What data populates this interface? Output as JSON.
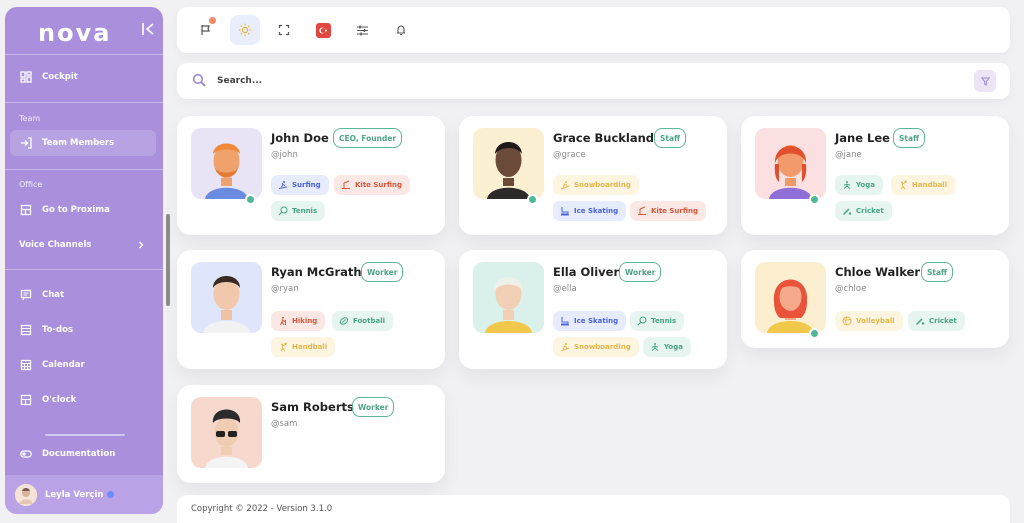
{
  "app": {
    "logo": "nova"
  },
  "sidebar": {
    "cockpit": "Cockpit",
    "team_section": "Team",
    "team_members": "Team Members",
    "office_section": "Office",
    "go_to_proxima": "Go to Proxima",
    "voice_channels": "Voice Channels",
    "chat": "Chat",
    "todos": "To-dos",
    "calendar": "Calendar",
    "oclock": "O'clock",
    "documentation": "Documentation",
    "user_name": "Leyla Verçin"
  },
  "search": {
    "placeholder": "Search..."
  },
  "members": [
    {
      "name": "John Doe",
      "role": "CEO, Founder",
      "handle": "@john",
      "tags": [
        "Surfing",
        "Kite Surfing",
        "Tennis"
      ]
    },
    {
      "name": "Grace Buckland",
      "role": "Staff",
      "handle": "@grace",
      "tags": [
        "Snowboarding",
        "Ice Skating",
        "Kite Surfing"
      ]
    },
    {
      "name": "Jane Lee",
      "role": "Staff",
      "handle": "@jane",
      "tags": [
        "Yoga",
        "Handball",
        "Cricket"
      ]
    },
    {
      "name": "Ryan McGrath",
      "role": "Worker",
      "handle": "@ryan",
      "tags": [
        "Hiking",
        "Football",
        "Handball"
      ]
    },
    {
      "name": "Ella Oliver",
      "role": "Worker",
      "handle": "@ella",
      "tags": [
        "Ice Skating",
        "Tennis",
        "Snowboarding",
        "Yoga"
      ]
    },
    {
      "name": "Chloe Walker",
      "role": "Staff",
      "handle": "@chloe",
      "tags": [
        "Volleyball",
        "Cricket"
      ]
    },
    {
      "name": "Sam Roberts",
      "role": "Worker",
      "handle": "@sam",
      "tags": []
    }
  ],
  "footer": {
    "copyright": "Copyright © 2022 - Version 3.1.0"
  },
  "colors": {
    "sidebar": "#a98fdc",
    "accent_green": "#4fb89a",
    "tag_blue": "#4a63d8",
    "tag_red": "#d8563a",
    "tag_green": "#46a386",
    "tag_yellow": "#e6b54a"
  }
}
